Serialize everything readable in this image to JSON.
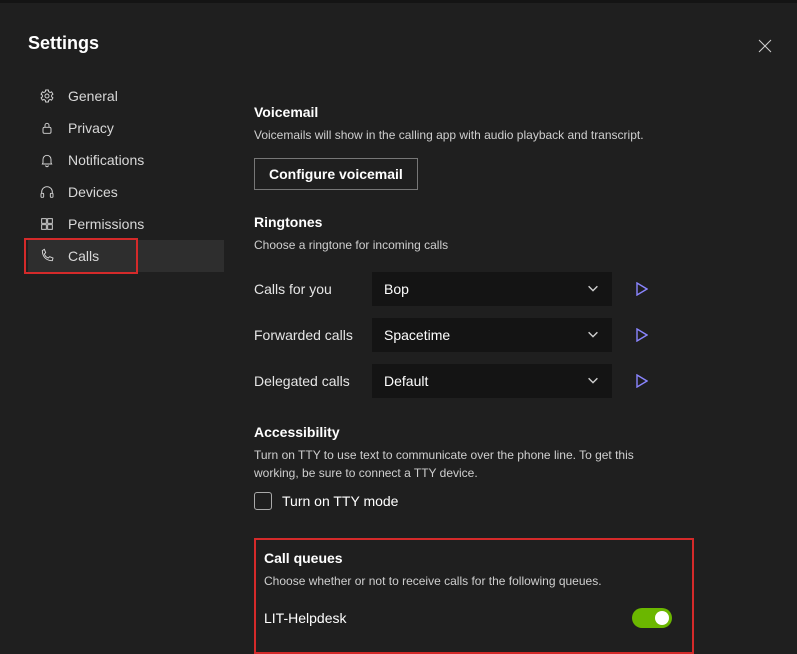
{
  "header": {
    "title": "Settings"
  },
  "sidebar": {
    "items": [
      {
        "label": "General"
      },
      {
        "label": "Privacy"
      },
      {
        "label": "Notifications"
      },
      {
        "label": "Devices"
      },
      {
        "label": "Permissions"
      },
      {
        "label": "Calls"
      }
    ]
  },
  "voicemail": {
    "title": "Voicemail",
    "subtitle": "Voicemails will show in the calling app with audio playback and transcript.",
    "button": "Configure voicemail"
  },
  "ringtones": {
    "title": "Ringtones",
    "subtitle": "Choose a ringtone for incoming calls",
    "rows": [
      {
        "label": "Calls for you",
        "value": "Bop"
      },
      {
        "label": "Forwarded calls",
        "value": "Spacetime"
      },
      {
        "label": "Delegated calls",
        "value": "Default"
      }
    ]
  },
  "accessibility": {
    "title": "Accessibility",
    "subtitle": "Turn on TTY to use text to communicate over the phone line. To get this working, be sure to connect a TTY device.",
    "checkbox_label": "Turn on TTY mode"
  },
  "call_queues": {
    "title": "Call queues",
    "subtitle": "Choose whether or not to receive calls for the following queues.",
    "items": [
      {
        "label": "LIT-Helpdesk",
        "enabled": true
      }
    ]
  }
}
